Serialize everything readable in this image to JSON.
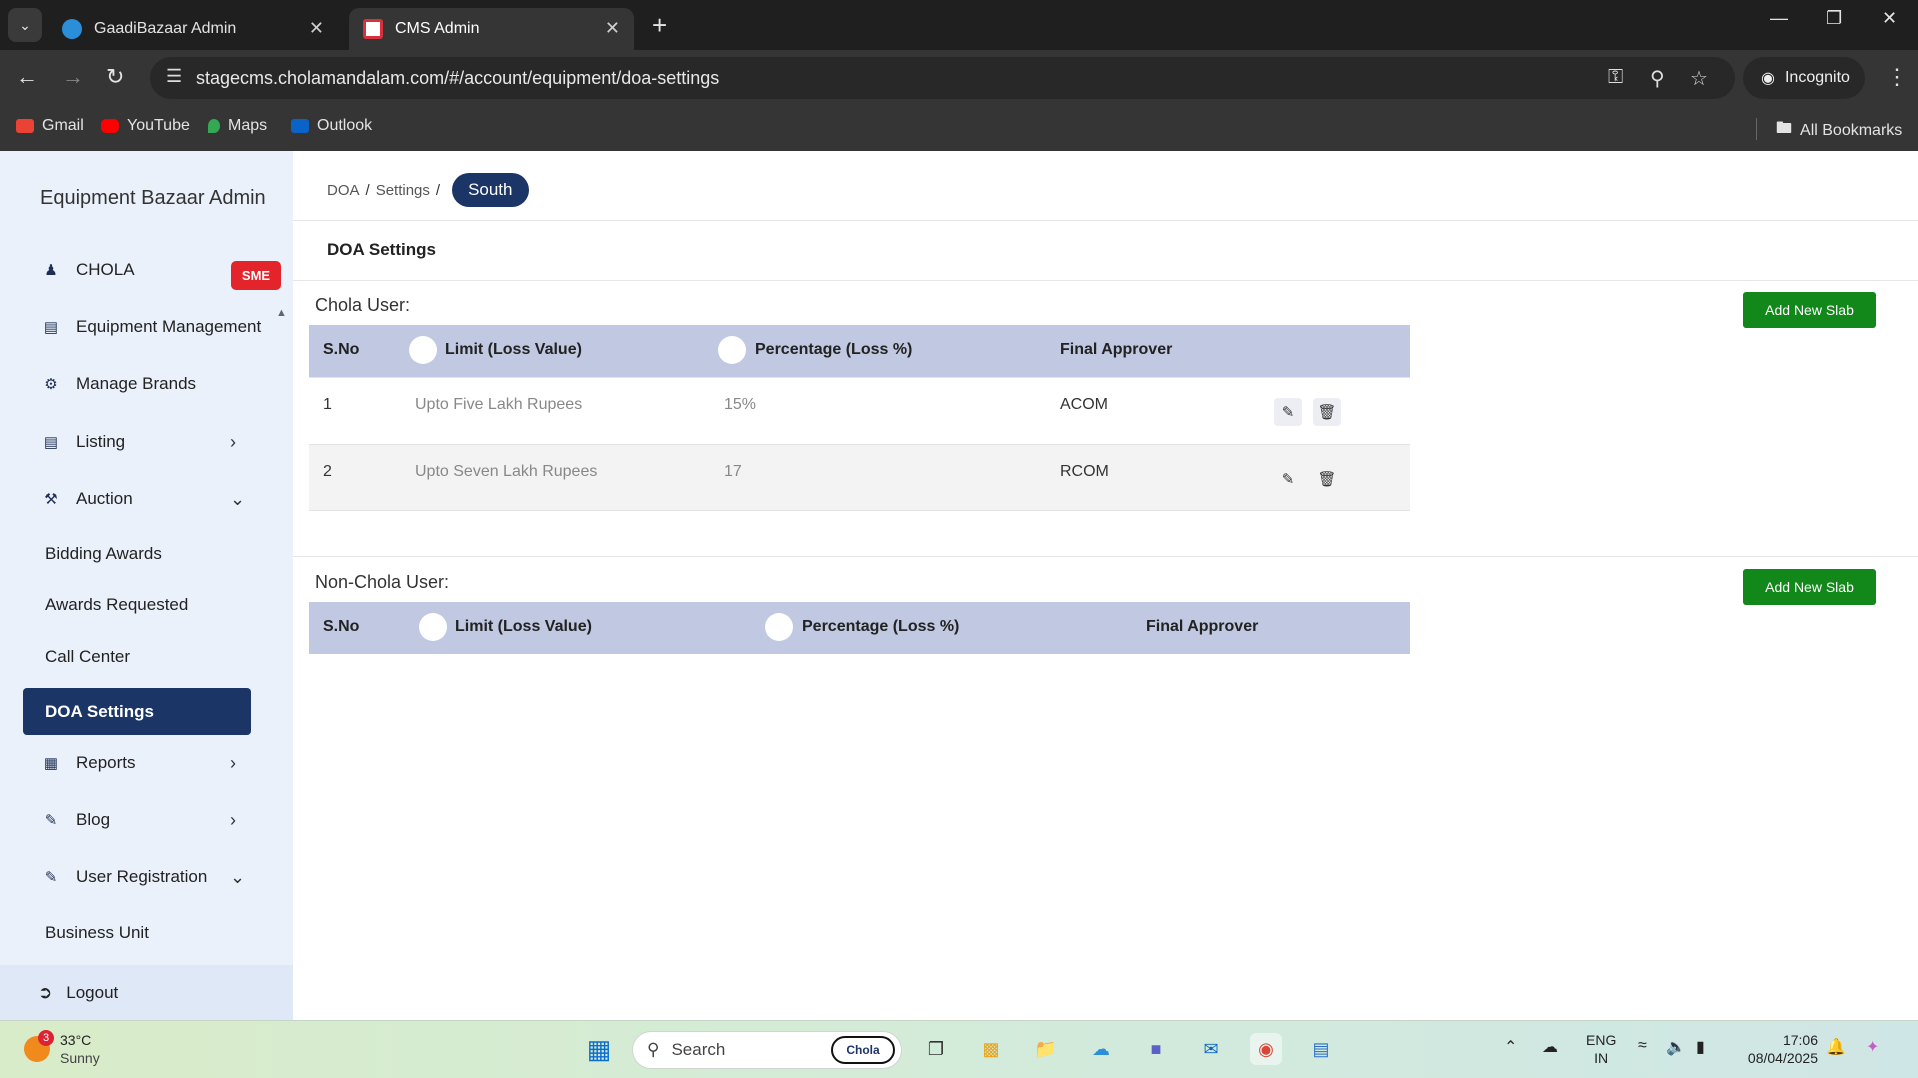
{
  "browser": {
    "tabs": [
      {
        "title": "GaadiBazaar Admin"
      },
      {
        "title": "CMS Admin"
      }
    ],
    "url": "stagecms.cholamandalam.com/#/account/equipment/doa-settings",
    "incognito_label": "Incognito",
    "bookmarks": [
      "Gmail",
      "YouTube",
      "Maps",
      "Outlook"
    ],
    "all_bookmarks_label": "All Bookmarks"
  },
  "sidebar": {
    "brand": "Equipment Bazaar Admin",
    "items": [
      {
        "label": "CHOLA",
        "icon": "user-icon",
        "badge": "SME"
      },
      {
        "label": "Equipment Management",
        "icon": "list-icon"
      },
      {
        "label": "Manage Brands",
        "icon": "brand-icon"
      },
      {
        "label": "Listing",
        "icon": "list-icon",
        "chevron": "right"
      },
      {
        "label": "Auction",
        "icon": "gavel-icon",
        "chevron": "down"
      },
      {
        "label": "Bidding Awards"
      },
      {
        "label": "Awards Requested"
      },
      {
        "label": "Call Center"
      },
      {
        "label": "DOA Settings",
        "active": true
      },
      {
        "label": "Reports",
        "icon": "report-icon",
        "chevron": "right"
      },
      {
        "label": "Blog",
        "icon": "blog-icon",
        "chevron": "right"
      },
      {
        "label": "User Registration",
        "icon": "user-edit-icon",
        "chevron": "down"
      },
      {
        "label": "Business Unit"
      }
    ],
    "logout": "Logout"
  },
  "breadcrumb": {
    "items": [
      "DOA",
      "Settings"
    ],
    "current": "South"
  },
  "page_title": "DOA Settings",
  "chola_section": {
    "label": "Chola User:",
    "add_button": "Add New Slab",
    "columns": [
      "S.No",
      "Limit (Loss Value)",
      "Percentage (Loss %)",
      "Final Approver"
    ],
    "rows": [
      {
        "sno": "1",
        "limit": "Upto Five Lakh Rupees",
        "percentage": "15%",
        "approver": "ACOM"
      },
      {
        "sno": "2",
        "limit": "Upto Seven Lakh Rupees",
        "percentage": "17",
        "approver": "RCOM"
      }
    ]
  },
  "non_chola_section": {
    "label": "Non-Chola User:",
    "add_button": "Add New Slab",
    "columns": [
      "S.No",
      "Limit (Loss Value)",
      "Percentage (Loss %)",
      "Final Approver"
    ]
  },
  "taskbar": {
    "weather_temp": "33°C",
    "weather_desc": "Sunny",
    "weather_badge": "3",
    "search_label": "Search",
    "chola_label": "Chola",
    "lang_1": "ENG",
    "lang_2": "IN",
    "time": "17:06",
    "date": "08/04/2025"
  },
  "colors": {
    "sidebar_bg": "#eaf1fb",
    "active_nav": "#1b3567",
    "table_header": "#c0c9e1",
    "add_button": "#12871a",
    "sme_badge": "#e3242b"
  }
}
